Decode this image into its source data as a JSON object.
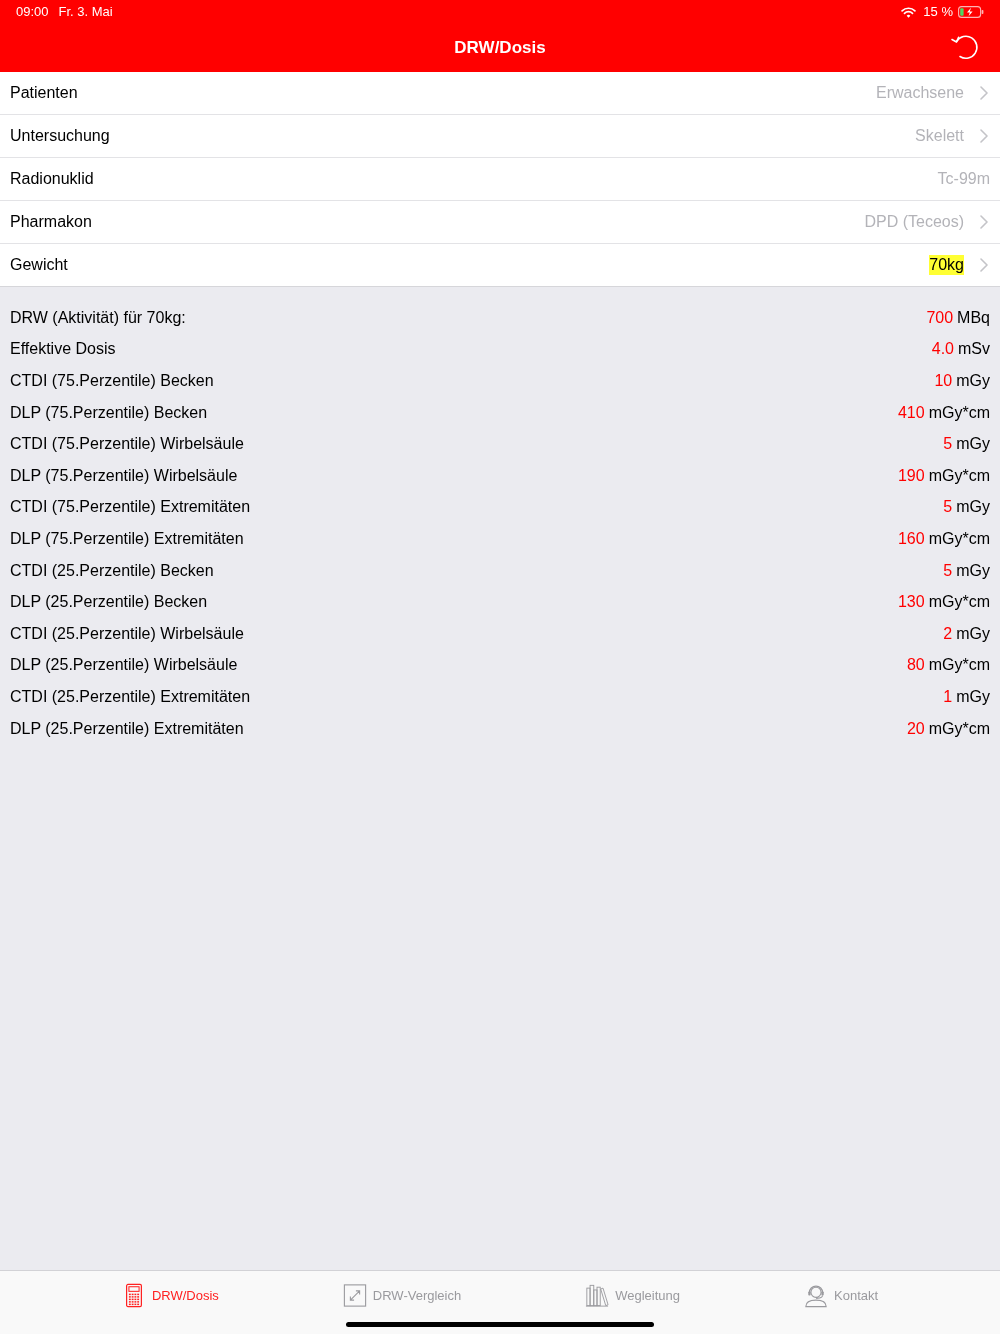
{
  "status_bar": {
    "time": "09:00",
    "date": "Fr. 3. Mai",
    "battery": "15 %"
  },
  "nav_bar": {
    "title": "DRW/Dosis"
  },
  "settings": [
    {
      "label": "Patienten",
      "value": "Erwachsene",
      "disclosure": true,
      "highlighted": false
    },
    {
      "label": "Untersuchung",
      "value": "Skelett",
      "disclosure": true,
      "highlighted": false
    },
    {
      "label": "Radionuklid",
      "value": "Tc-99m",
      "disclosure": false,
      "highlighted": false
    },
    {
      "label": "Pharmakon",
      "value": "DPD (Teceos)",
      "disclosure": true,
      "highlighted": false
    },
    {
      "label": "Gewicht",
      "value": "70kg",
      "disclosure": true,
      "highlighted": true
    }
  ],
  "results": [
    {
      "label": "DRW (Aktivität) für 70kg:",
      "value": "700",
      "unit": "MBq"
    },
    {
      "label": "Effektive Dosis",
      "value": "4.0",
      "unit": "mSv"
    },
    {
      "label": "CTDI (75.Perzentile) Becken",
      "value": "10",
      "unit": "mGy"
    },
    {
      "label": "DLP (75.Perzentile) Becken",
      "value": "410",
      "unit": "mGy*cm"
    },
    {
      "label": "CTDI (75.Perzentile) Wirbelsäule",
      "value": "5",
      "unit": "mGy"
    },
    {
      "label": "DLP (75.Perzentile) Wirbelsäule",
      "value": "190",
      "unit": "mGy*cm"
    },
    {
      "label": "CTDI (75.Perzentile) Extremitäten",
      "value": "5",
      "unit": "mGy"
    },
    {
      "label": "DLP (75.Perzentile) Extremitäten",
      "value": "160",
      "unit": "mGy*cm"
    },
    {
      "label": "CTDI (25.Perzentile) Becken",
      "value": "5",
      "unit": "mGy"
    },
    {
      "label": "DLP (25.Perzentile) Becken",
      "value": "130",
      "unit": "mGy*cm"
    },
    {
      "label": "CTDI (25.Perzentile) Wirbelsäule",
      "value": "2",
      "unit": "mGy"
    },
    {
      "label": "DLP (25.Perzentile) Wirbelsäule",
      "value": "80",
      "unit": "mGy*cm"
    },
    {
      "label": "CTDI (25.Perzentile) Extremitäten",
      "value": "1",
      "unit": "mGy"
    },
    {
      "label": "DLP (25.Perzentile) Extremitäten",
      "value": "20",
      "unit": "mGy*cm"
    }
  ],
  "tab_bar": [
    {
      "label": "DRW/Dosis",
      "selected": true
    },
    {
      "label": "DRW-Vergleich",
      "selected": false
    },
    {
      "label": "Wegleitung",
      "selected": false
    },
    {
      "label": "Kontakt",
      "selected": false
    }
  ]
}
